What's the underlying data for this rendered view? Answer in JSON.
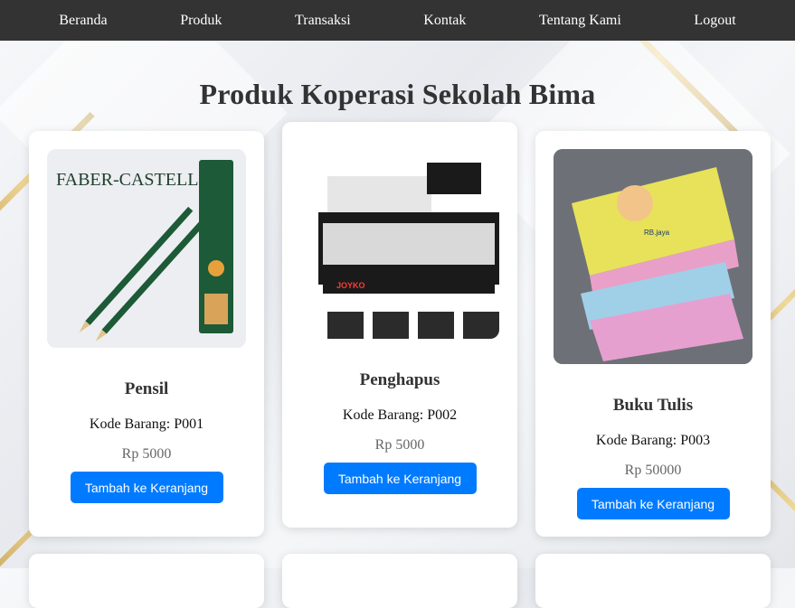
{
  "nav": {
    "items": [
      "Beranda",
      "Produk",
      "Transaksi",
      "Kontak",
      "Tentang Kami",
      "Logout"
    ]
  },
  "page": {
    "title": "Produk Koperasi Sekolah Bima"
  },
  "products": [
    {
      "name": "Pensil",
      "code": "Kode Barang: P001",
      "price": "Rp 5000",
      "button": "Tambah ke Keranjang",
      "image_brand": "FABER-CASTELL"
    },
    {
      "name": "Penghapus",
      "code": "Kode Barang: P002",
      "price": "Rp 5000",
      "button": "Tambah ke Keranjang",
      "image_brand": "JOYKO"
    },
    {
      "name": "Buku Tulis",
      "code": "Kode Barang: P003",
      "price": "Rp 50000",
      "button": "Tambah ke Keranjang",
      "image_brand": "RB.jaya"
    }
  ],
  "colors": {
    "nav_bg": "#333333",
    "button_bg": "#007bff",
    "gold_accent": "#c9a34a"
  }
}
